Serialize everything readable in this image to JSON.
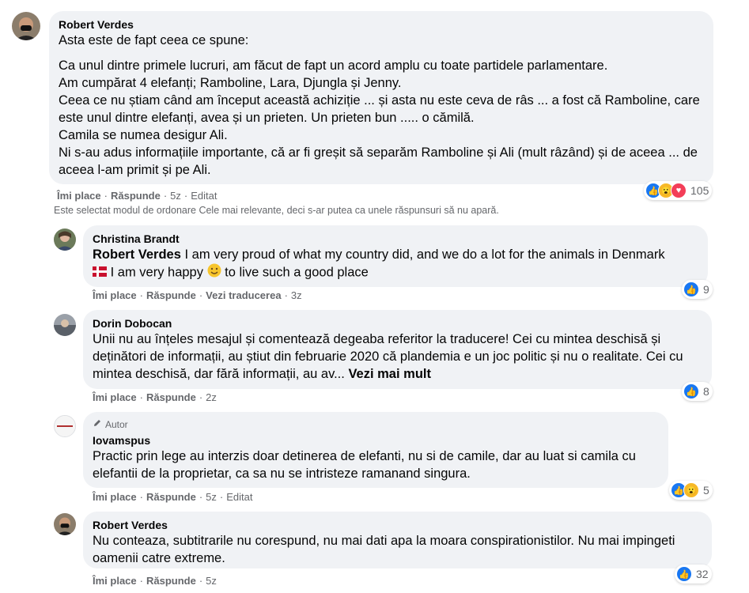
{
  "comments": [
    {
      "author": "Robert Verdes",
      "paragraphs": [
        "Asta este de fapt ceea ce spune:",
        "Ca unul dintre primele lucruri, am făcut de fapt un acord amplu cu toate partidele parlamentare.",
        "Am cumpărat 4 elefanți; Ramboline, Lara, Djungla și Jenny.",
        "Ceea ce nu știam când am început această achiziție ... și asta nu este ceva de râs ... a fost că Ramboline, care este unul dintre elefanți, avea și un prieten. Un prieten bun ..... o cămilă.",
        "Camila se numea desigur Ali.",
        "Ni s-au adus informațiile importante, că ar fi greșit să separăm Ramboline și Ali (mult râzând) și de aceea ... de aceea l-am primit și pe Ali."
      ],
      "like_label": "Îmi place",
      "reply_label": "Răspunde",
      "time": "5z",
      "edited": "Editat",
      "reaction_count": "105"
    },
    {
      "author": "Christina Brandt",
      "mention": "Robert Verdes",
      "text_line1": "I am very proud of what my country did, and we do a lot for the animals in Denmark",
      "text_line2a": "I am very happy",
      "text_line2b": "to live such a good place",
      "like_label": "Îmi place",
      "reply_label": "Răspunde",
      "translate_label": "Vezi traducerea",
      "time": "3z",
      "reaction_count": "9"
    },
    {
      "author": "Dorin Dobocan",
      "text": "Unii nu au înțeles mesajul și comentează degeaba referitor la traducere! Cei cu mintea deschisă și deținători de informații, au știut din februarie 2020 că plandemia e un joc politic și nu o realitate. Cei cu mintea deschisă, dar fără informații, au av...",
      "see_more": "Vezi mai mult",
      "like_label": "Îmi place",
      "reply_label": "Răspunde",
      "time": "2z",
      "reaction_count": "8"
    },
    {
      "badge": "Autor",
      "author": "Iovamspus",
      "text": "Practic prin lege au interzis doar detinerea de elefanti, nu si de camile, dar au luat si camila cu elefantii de la proprietar, ca sa nu se intristeze ramanand singura.",
      "like_label": "Îmi place",
      "reply_label": "Răspunde",
      "time": "5z",
      "edited": "Editat",
      "reaction_count": "5"
    },
    {
      "author": "Robert Verdes",
      "text": "Nu conteaza, subtitrarile nu corespund, nu mai dati apa la moara conspirationistilor. Nu mai impingeti oamenii catre extreme.",
      "like_label": "Îmi place",
      "reply_label": "Răspunde",
      "time": "5z",
      "reaction_count": "32"
    }
  ],
  "sort_notice": "Este selectat modul de ordonare Cele mai relevante, deci s-ar putea ca unele răspunsuri să nu apară.",
  "colors": {
    "bubble": "#f0f2f5",
    "secondary_text": "#65676b",
    "like_blue": "#1877f2",
    "love_red": "#f33e58",
    "wow_yellow": "#f7b928"
  },
  "icons": {
    "like": "like-reaction-icon",
    "wow": "wow-reaction-icon",
    "love": "love-reaction-icon",
    "pencil": "pencil-icon",
    "flag": "denmark-flag-icon",
    "smile": "smile-emoji-icon"
  }
}
